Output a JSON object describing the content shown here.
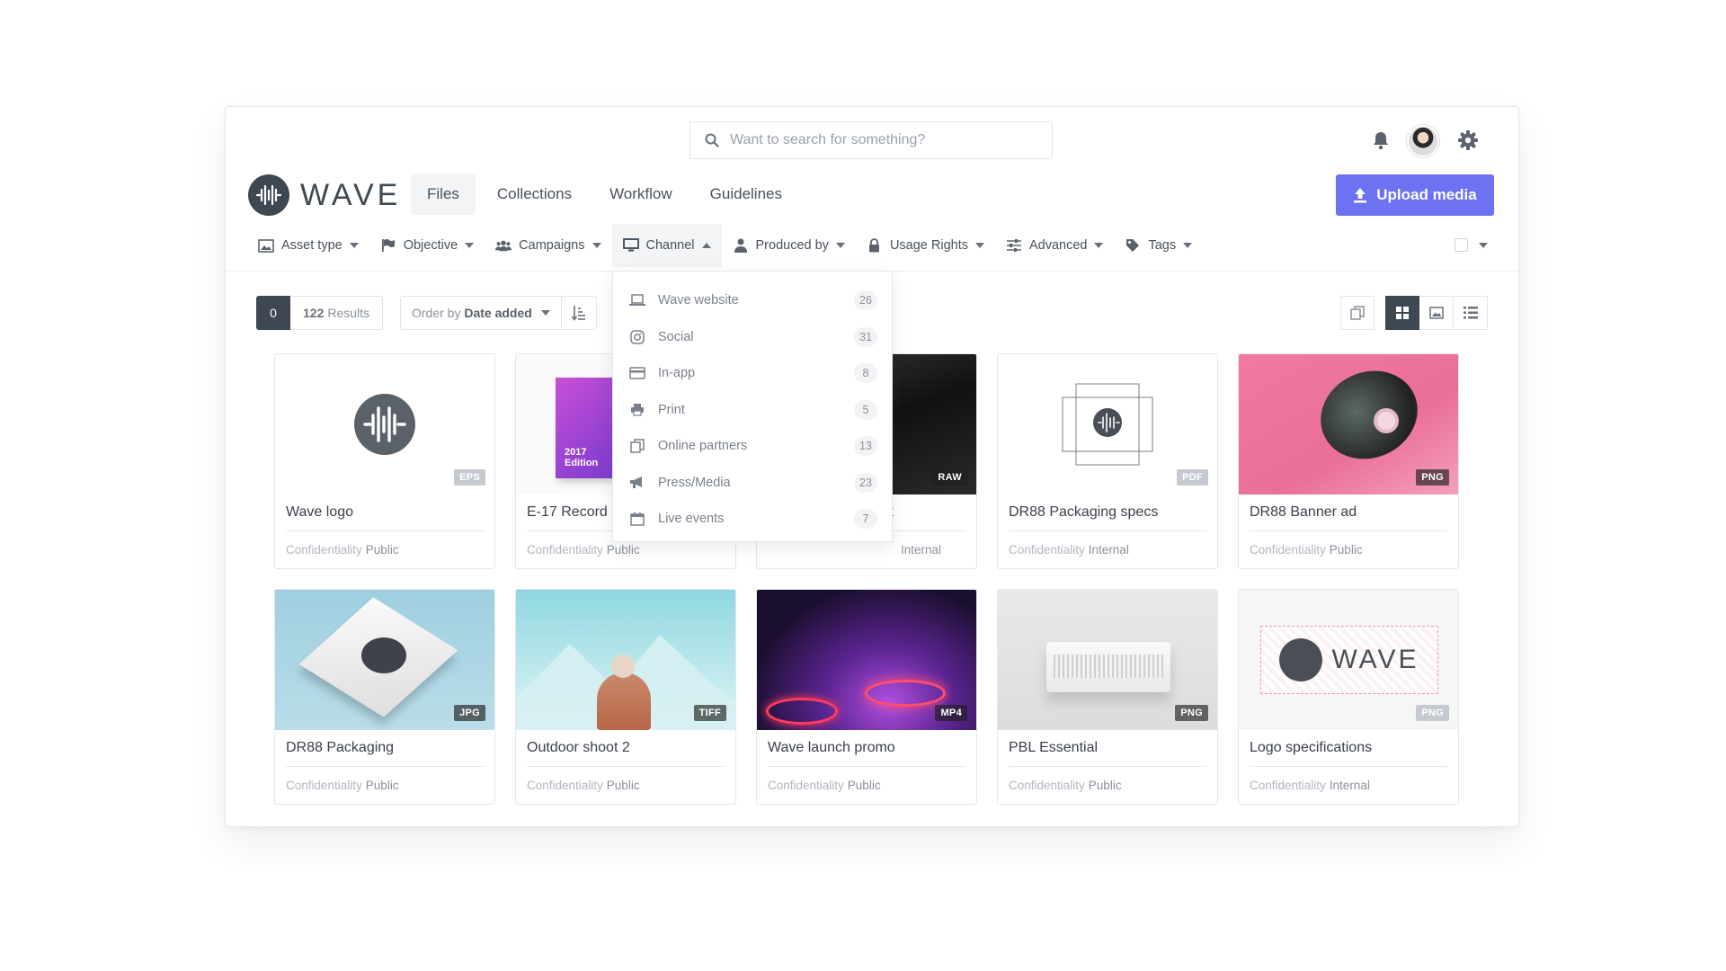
{
  "header": {
    "search_placeholder": "Want to search for something?",
    "logo_text": "WAVE",
    "upload_label": "Upload media"
  },
  "nav": {
    "tabs": [
      {
        "label": "Files",
        "active": true
      },
      {
        "label": "Collections"
      },
      {
        "label": "Workflow"
      },
      {
        "label": "Guidelines"
      }
    ]
  },
  "filters": [
    {
      "label": "Asset type",
      "icon": "image-icon"
    },
    {
      "label": "Objective",
      "icon": "flag-icon"
    },
    {
      "label": "Campaigns",
      "icon": "users-icon"
    },
    {
      "label": "Channel",
      "icon": "monitor-icon",
      "open": true
    },
    {
      "label": "Produced by",
      "icon": "user-icon"
    },
    {
      "label": "Usage Rights",
      "icon": "lock-icon"
    },
    {
      "label": "Advanced",
      "icon": "sliders-icon"
    },
    {
      "label": "Tags",
      "icon": "tag-icon"
    }
  ],
  "channel_dropdown": [
    {
      "label": "Wave website",
      "count": "26",
      "icon": "laptop-icon"
    },
    {
      "label": "Social",
      "count": "31",
      "icon": "instagram-icon"
    },
    {
      "label": "In-app",
      "count": "8",
      "icon": "credit-card-icon"
    },
    {
      "label": "Print",
      "count": "5",
      "icon": "printer-icon"
    },
    {
      "label": "Online partners",
      "count": "13",
      "icon": "copy-icon"
    },
    {
      "label": "Press/Media",
      "count": "23",
      "icon": "megaphone-icon"
    },
    {
      "label": "Live events",
      "count": "7",
      "icon": "calendar-icon"
    }
  ],
  "results": {
    "selected_count": "0",
    "count": "122",
    "count_label": "Results",
    "order_prefix": "Order by",
    "order_value": "Date added"
  },
  "confidentiality_label": "Confidentiality",
  "cards": [
    {
      "title": "Wave logo",
      "confidentiality": "Public",
      "format": "EPS"
    },
    {
      "title": "E-17 Record",
      "confidentiality": "Public",
      "format": "",
      "thumb_text": "2017 Edition"
    },
    {
      "title": "hirt",
      "confidentiality": "Internal",
      "format": "RAW"
    },
    {
      "title": "DR88 Packaging specs",
      "confidentiality": "Internal",
      "format": "PDF"
    },
    {
      "title": "DR88 Banner ad",
      "confidentiality": "Public",
      "format": "PNG"
    },
    {
      "title": "DR88 Packaging",
      "confidentiality": "Public",
      "format": "JPG"
    },
    {
      "title": "Outdoor shoot 2",
      "confidentiality": "Public",
      "format": "TIFF"
    },
    {
      "title": "Wave launch promo",
      "confidentiality": "Public",
      "format": "MP4"
    },
    {
      "title": "PBL Essential",
      "confidentiality": "Public",
      "format": "PNG"
    },
    {
      "title": "Logo specifications",
      "confidentiality": "Internal",
      "format": "PNG",
      "thumb_text": "WAVE"
    }
  ],
  "colors": {
    "accent": "#6c72f2",
    "dark": "#3d4852"
  }
}
